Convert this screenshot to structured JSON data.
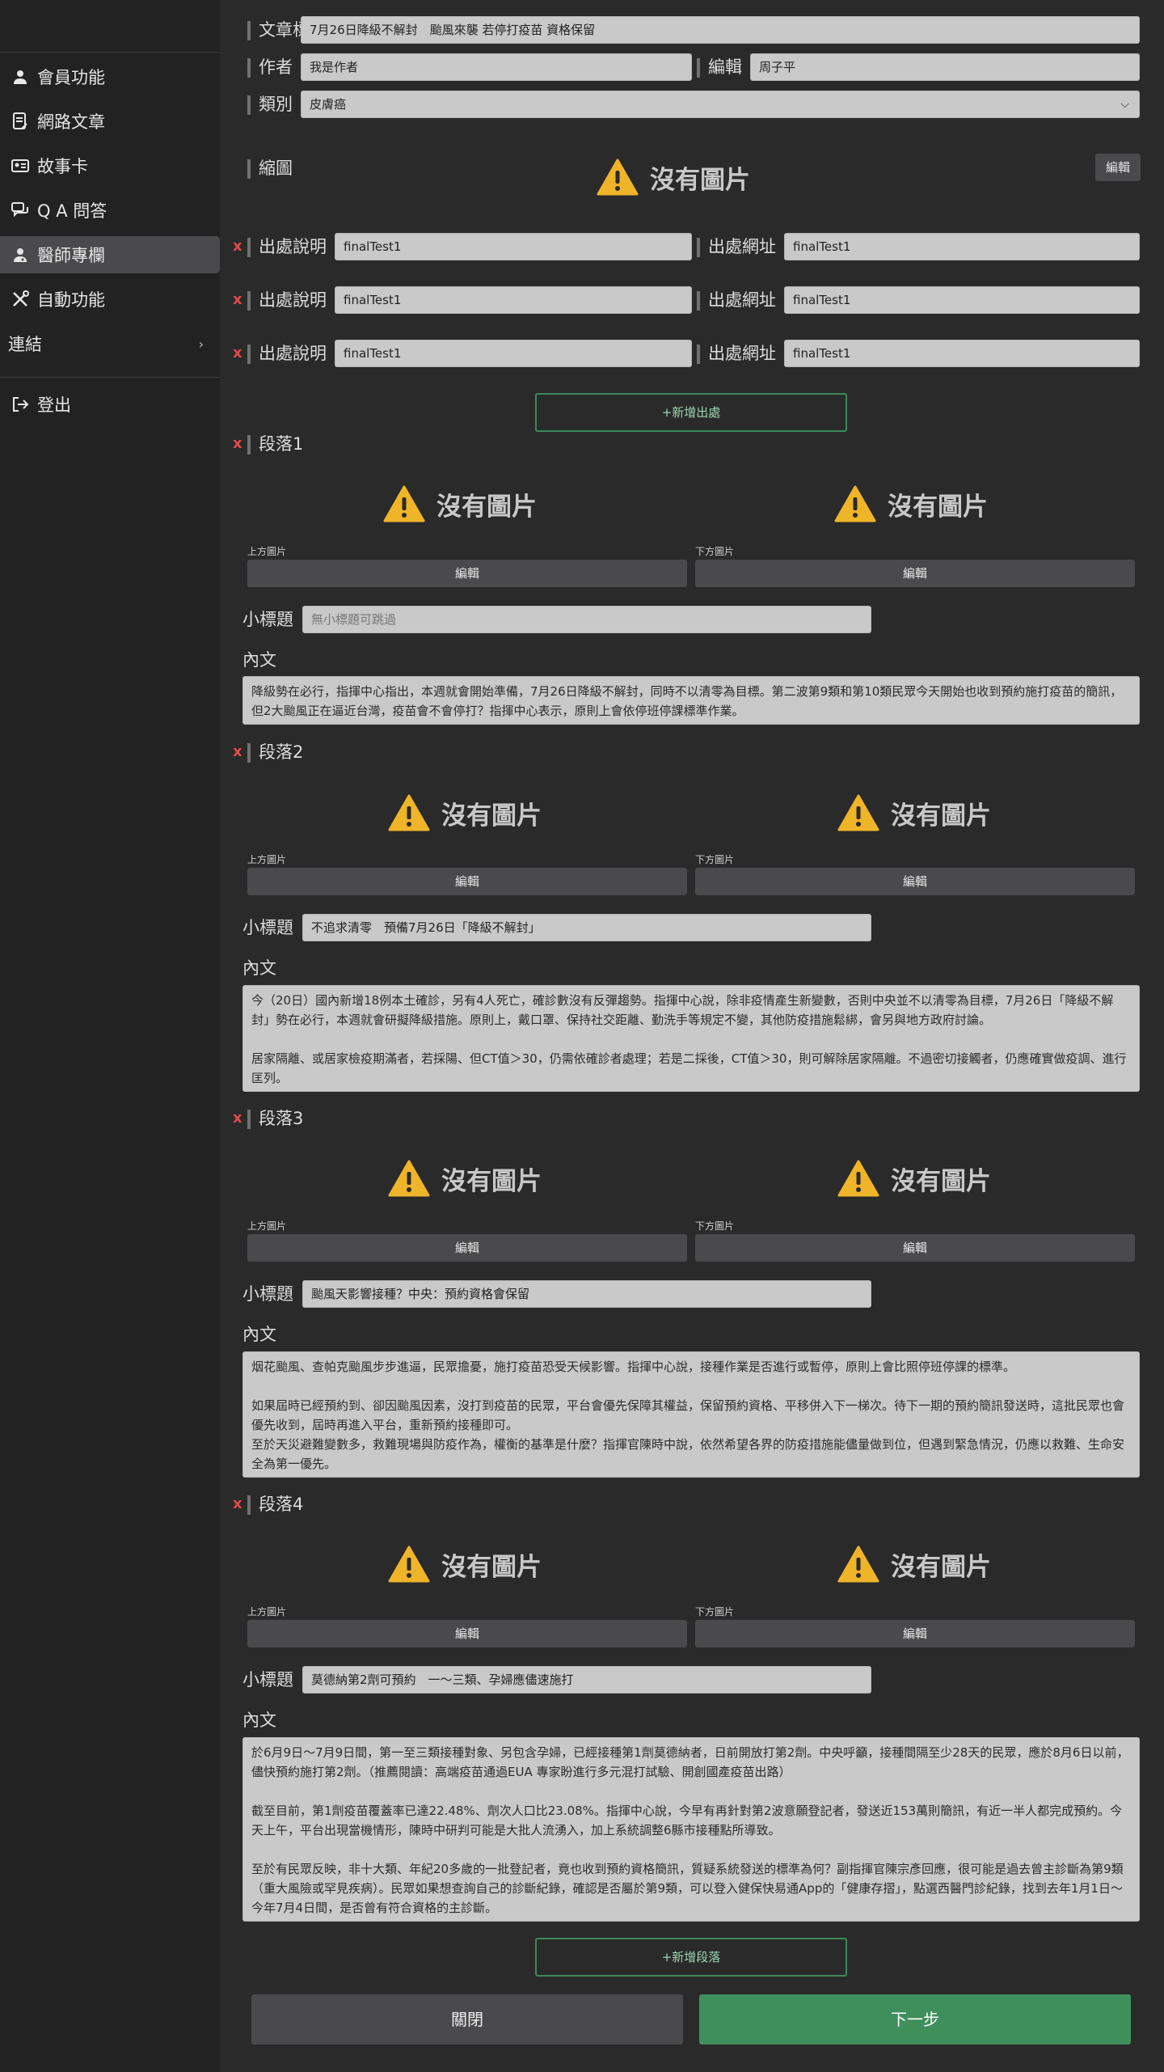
{
  "sidebar": {
    "items": [
      {
        "label": "會員功能",
        "icon": "user-icon"
      },
      {
        "label": "網路文章",
        "icon": "document-icon"
      },
      {
        "label": "故事卡",
        "icon": "id-card-icon"
      },
      {
        "label": "Q A 問答",
        "icon": "chat-icon"
      },
      {
        "label": "醫師專欄",
        "icon": "doctor-icon"
      },
      {
        "label": "自動功能",
        "icon": "tools-icon"
      },
      {
        "label": "連結",
        "icon": "chevron-right-icon"
      },
      {
        "label": "登出",
        "icon": "logout-icon"
      }
    ],
    "active": "醫師專欄"
  },
  "article": {
    "title_label": "文章標題",
    "title_value": "7月26日降級不解封　颱風來襲 若停打疫苗 資格保留",
    "author_label": "作者",
    "author_value": "我是作者",
    "editor_label": "編輯",
    "editor_value": "周子平",
    "category_label": "類別",
    "category_value": "皮膚癌",
    "thumbnail_label": "縮圖",
    "thumbnail_edit": "編輯",
    "no_image": "沒有圖片"
  },
  "sources": [
    {
      "x": "x",
      "desc_label": "出處說明",
      "desc_value": "finalTest1",
      "url_label": "出處網址",
      "url_value": "finalTest1"
    },
    {
      "x": "x",
      "desc_label": "出處說明",
      "desc_value": "finalTest1",
      "url_label": "出處網址",
      "url_value": "finalTest1"
    },
    {
      "x": "x",
      "desc_label": "出處說明",
      "desc_value": "finalTest1",
      "url_label": "出處網址",
      "url_value": "finalTest1"
    }
  ],
  "add_source": "+新增出處",
  "common": {
    "top_image": "上方圖片",
    "bottom_image": "下方圖片",
    "edit": "編輯",
    "subtitle_label": "小標題",
    "content_label": "內文",
    "x": "x"
  },
  "paragraphs": [
    {
      "title": "段落1",
      "subtitle": "無小標題可跳過",
      "content": "降級勢在必行，指揮中心指出，本週就會開始準備，7月26日降級不解封，同時不以清零為目標。第二波第9類和第10類民眾今天開始也收到預約施打疫苗的簡訊，但2大颱風正在逼近台灣，疫苗會不會停打？指揮中心表示，原則上會依停班停課標準作業。"
    },
    {
      "title": "段落2",
      "subtitle": "不追求清零　預備7月26日「降級不解封」",
      "content": "今（20日）國內新增18例本土確診，另有4人死亡，確診數沒有反彈趨勢。指揮中心說，除非疫情產生新變數，否則中央並不以清零為目標，7月26日「降級不解封」勢在必行，本週就會研擬降級措施。原則上，戴口罩、保持社交距離、勤洗手等規定不變，其他防疫措施鬆綁，會另與地方政府討論。\n\n居家隔離、或居家檢疫期滿者，若採陽、但CT值＞30，仍需依確診者處理；若是二採後，CT值＞30，則可解除居家隔離。不過密切接觸者，仍應確實做疫調、進行匡列。"
    },
    {
      "title": "段落3",
      "subtitle": "颱風天影響接種？中央：預約資格會保留",
      "content": "烟花颱風、查帕克颱風步步進逼，民眾擔憂，施打疫苗恐受天候影響。指揮中心說，接種作業是否進行或暫停，原則上會比照停班停課的標準。\n\n如果屆時已經預約到、卻因颱風因素，沒打到疫苗的民眾，平台會優先保障其權益，保留預約資格、平移併入下一梯次。待下一期的預約簡訊發送時，這批民眾也會優先收到，屆時再進入平台，重新預約接種即可。\n至於天災避難變數多，救難現場與防疫作為，權衡的基準是什麼？指揮官陳時中說，依然希望各界的防疫措施能儘量做到位，但遇到緊急情況，仍應以救難、生命安全為第一優先。"
    },
    {
      "title": "段落4",
      "subtitle": "莫德納第2劑可預約　一～三類、孕婦應儘速施打",
      "content": "於6月9日～7月9日間，第一至三類接種對象、另包含孕婦，已經接種第1劑莫德納者，日前開放打第2劑。中央呼籲，接種間隔至少28天的民眾，應於8月6日以前，儘快預約施打第2劑。（推薦閱讀：高端疫苗通過EUA 專家盼進行多元混打試驗、開創國產疫苗出路）\n\n截至目前，第1劑疫苗覆蓋率已達22.48%、劑次人口比23.08%。指揮中心說，今早有再針對第2波意願登記者，發送近153萬則簡訊，有近一半人都完成預約。今天上午，平台出現當機情形，陳時中研判可能是大批人流湧入，加上系統調整6縣市接種點所導致。\n\n至於有民眾反映，非十大類、年紀20多歲的一批登記者，竟也收到預約資格簡訊，質疑系統發送的標準為何？副指揮官陳宗彥回應，很可能是過去曾主診斷為第9類（重大風險或罕見疾病）。民眾如果想查詢自己的診斷紀錄，確認是否屬於第9類，可以登入健保快易通App的「健康存摺」，點選西醫門診紀錄，找到去年1月1日～今年7月4日間，是否曾有符合資格的主診斷。"
    }
  ],
  "add_paragraph": "+新增段落",
  "footer": {
    "close": "關閉",
    "next": "下一步"
  },
  "colors": {
    "accent_green": "#3f8f5d",
    "warning": "#f0b429",
    "danger": "#e04a4a"
  }
}
